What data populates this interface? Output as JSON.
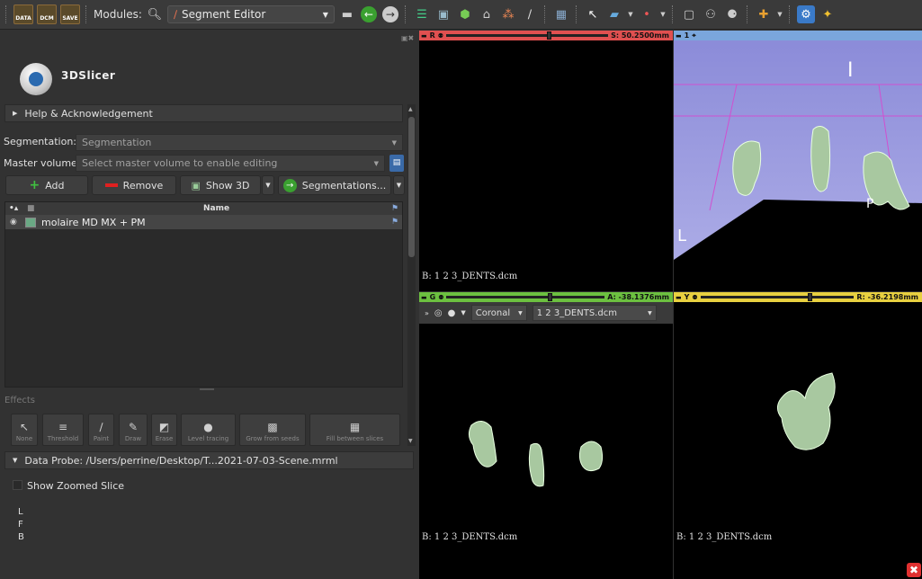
{
  "toolbar": {
    "file_icons": [
      "DATA",
      "DCM",
      "SAVE"
    ],
    "modules_label": "Modules:",
    "module_selected": "Segment Editor"
  },
  "app": {
    "name": "3DSlicer"
  },
  "help": {
    "label": "Help & Acknowledgement"
  },
  "segmentation": {
    "label": "Segmentation:",
    "value": "Segmentation"
  },
  "master_volume": {
    "label": "Master volume:",
    "value": "Select master volume to enable editing"
  },
  "actions": {
    "add": "Add",
    "remove": "Remove",
    "show3d": "Show 3D",
    "segmentations": "Segmentations..."
  },
  "table": {
    "column_name": "Name",
    "rows": [
      {
        "name": "molaire MD MX + PM",
        "color": "#6aa884"
      }
    ]
  },
  "effects": {
    "label": "Effects",
    "tools": [
      "None",
      "Threshold",
      "Paint",
      "Draw",
      "Erase",
      "Level tracing",
      "Grow from seeds",
      "Fill between slices"
    ]
  },
  "data_probe": {
    "label": "Data Probe: /Users/perrine/Desktop/T...2021-07-03-Scene.mrml",
    "show_zoomed": "Show Zoomed Slice",
    "lines": [
      "L",
      "F",
      "B"
    ]
  },
  "views": {
    "red": {
      "letter": "R",
      "offset": "S: 50.2500mm",
      "slider": 0.62,
      "label": "B: 1 2 3_DENTS.dcm",
      "color": "#e05050"
    },
    "threed": {
      "letter": "1",
      "color": "#7aa6dc",
      "orient_i": "I",
      "orient_l": "L",
      "orient_p": "P"
    },
    "green": {
      "letter": "G",
      "offset": "A: -38.1376mm",
      "slider": 0.64,
      "label": "B: 1 2 3_DENTS.dcm",
      "color": "#6cc040",
      "orientation": "Coronal",
      "volume": "1 2 3_DENTS.dcm"
    },
    "yellow": {
      "letter": "Y",
      "offset": "R: -36.2198mm",
      "slider": 0.7,
      "label": "B: 1 2 3_DENTS.dcm",
      "color": "#e8d040"
    }
  },
  "colors": {
    "accent_close": "#e03030"
  }
}
